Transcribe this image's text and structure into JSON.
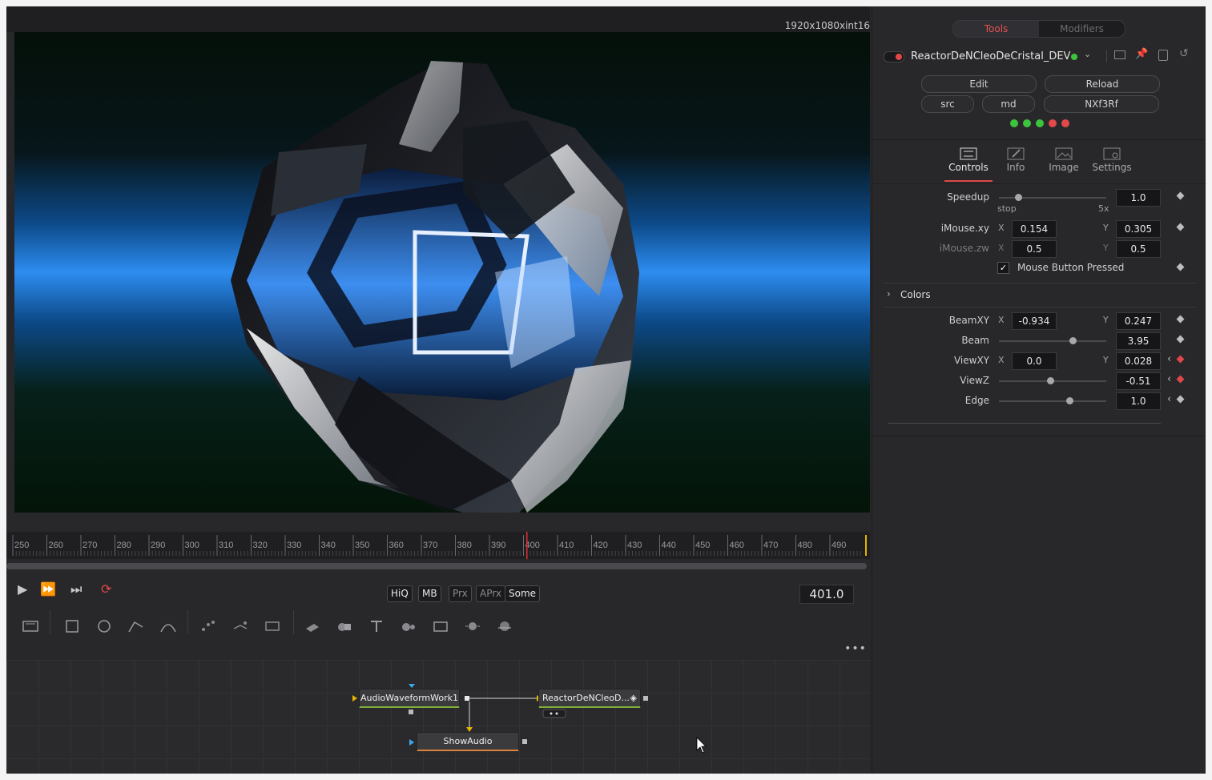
{
  "viewer": {
    "resolution": "1920x1080xint16"
  },
  "ruler": {
    "ticks": [
      "250",
      "260",
      "270",
      "280",
      "290",
      "300",
      "310",
      "320",
      "330",
      "340",
      "350",
      "360",
      "370",
      "380",
      "390",
      "400",
      "410",
      "420",
      "430",
      "440",
      "450",
      "460",
      "470",
      "480",
      "490"
    ]
  },
  "transport": {
    "hiq": "HiQ",
    "mb": "MB",
    "prx": "Prx",
    "aprx": "APrx",
    "some": "Some",
    "current_frame": "401.0"
  },
  "nodes": {
    "audio": "AudioWaveformWork1",
    "reactor": "ReactorDeNCleoD...",
    "show": "ShowAudio"
  },
  "inspector": {
    "tabs": {
      "tools": "Tools",
      "modifiers": "Modifiers"
    },
    "tool_name": "ReactorDeNCleoDeCristal_DEV",
    "buttons": {
      "edit": "Edit",
      "reload": "Reload",
      "src": "src",
      "md": "md",
      "id": "NXf3Rf"
    },
    "status_dots": [
      "#3cc43c",
      "#3cc43c",
      "#3cc43c",
      "#e24a4a",
      "#e24a4a"
    ],
    "panel_tabs": {
      "controls": "Controls",
      "info": "Info",
      "image": "Image",
      "settings": "Settings"
    },
    "controls": {
      "speedup": {
        "label": "Speedup",
        "value": "1.0",
        "min": "stop",
        "max": "5x",
        "level": 0.18
      },
      "imouse_xy": {
        "label": "iMouse.xy",
        "x": "0.154",
        "y": "0.305",
        "ax": "X",
        "ay": "Y"
      },
      "imouse_zw": {
        "label": "iMouse.zw",
        "x": "0.5",
        "y": "0.5",
        "ax": "X",
        "ay": "Y"
      },
      "mouse_button": {
        "label": "Mouse Button Pressed",
        "checked": true
      },
      "colors_section": "Colors",
      "beamxy": {
        "label": "BeamXY",
        "x": "-0.934",
        "y": "0.247",
        "ax": "X",
        "ay": "Y"
      },
      "beam": {
        "label": "Beam",
        "value": "3.95",
        "level": 0.69
      },
      "viewxy": {
        "label": "ViewXY",
        "x": "0.0",
        "y": "0.028",
        "ax": "X",
        "ay": "Y"
      },
      "viewz": {
        "label": "ViewZ",
        "value": "-0.51",
        "level": 0.48
      },
      "edge": {
        "label": "Edge",
        "value": "1.0",
        "level": 0.66
      }
    }
  },
  "colors": {
    "accent_red": "#e04848",
    "node_green": "#7fb03a",
    "node_orange": "#d9823d",
    "playhead": "#e03030"
  }
}
